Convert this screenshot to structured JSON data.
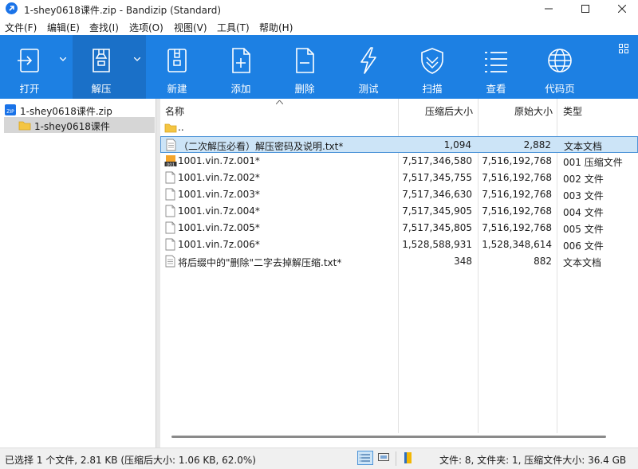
{
  "window": {
    "title": "1-shey0618课件.zip - Bandizip (Standard)"
  },
  "menu": [
    "文件(F)",
    "编辑(E)",
    "查找(I)",
    "选项(O)",
    "视图(V)",
    "工具(T)",
    "帮助(H)"
  ],
  "toolbar": {
    "buttons": [
      {
        "label": "打开",
        "icon": "open-icon"
      },
      {
        "label": "解压",
        "icon": "extract-icon"
      },
      {
        "label": "新建",
        "icon": "new-archive-icon"
      },
      {
        "label": "添加",
        "icon": "add-file-icon"
      },
      {
        "label": "删除",
        "icon": "delete-file-icon"
      },
      {
        "label": "测试",
        "icon": "test-lightning-icon"
      },
      {
        "label": "扫描",
        "icon": "scan-shield-icon"
      },
      {
        "label": "查看",
        "icon": "view-list-icon"
      },
      {
        "label": "代码页",
        "icon": "codepage-globe-icon"
      }
    ],
    "colors": {
      "background": "#1d80e3",
      "active": "#1a70c8"
    }
  },
  "tree": {
    "root": "1-shey0618课件.zip",
    "child": "1-shey0618课件"
  },
  "list": {
    "headers": {
      "name": "名称",
      "packed": "压缩后大小",
      "original": "原始大小",
      "type": "类型"
    },
    "parent_row": "..",
    "rows": [
      {
        "name": "（二次解压必看）解压密码及说明.txt*",
        "packed": "1,094",
        "original": "2,882",
        "type": "文本文档",
        "icon": "text-file-icon",
        "selected": true
      },
      {
        "name": "1001.vin.7z.001*",
        "packed": "7,517,346,580",
        "original": "7,516,192,768",
        "type": "001 压缩文件",
        "icon": "archive-001-icon",
        "selected": false
      },
      {
        "name": "1001.vin.7z.002*",
        "packed": "7,517,345,755",
        "original": "7,516,192,768",
        "type": "002 文件",
        "icon": "file-icon",
        "selected": false
      },
      {
        "name": "1001.vin.7z.003*",
        "packed": "7,517,346,630",
        "original": "7,516,192,768",
        "type": "003 文件",
        "icon": "file-icon",
        "selected": false
      },
      {
        "name": "1001.vin.7z.004*",
        "packed": "7,517,345,905",
        "original": "7,516,192,768",
        "type": "004 文件",
        "icon": "file-icon",
        "selected": false
      },
      {
        "name": "1001.vin.7z.005*",
        "packed": "7,517,345,805",
        "original": "7,516,192,768",
        "type": "005 文件",
        "icon": "file-icon",
        "selected": false
      },
      {
        "name": "1001.vin.7z.006*",
        "packed": "1,528,588,931",
        "original": "1,528,348,614",
        "type": "006 文件",
        "icon": "file-icon",
        "selected": false
      },
      {
        "name": "将后缀中的\"删除\"二字去掉解压缩.txt*",
        "packed": "348",
        "original": "882",
        "type": "文本文档",
        "icon": "text-file-icon",
        "selected": false
      }
    ]
  },
  "status": {
    "left": "已选择 1 个文件, 2.81 KB (压缩后大小: 1.06 KB, 62.0%)",
    "right": "文件: 8, 文件夹: 1, 压缩文件大小: 36.4 GB"
  }
}
